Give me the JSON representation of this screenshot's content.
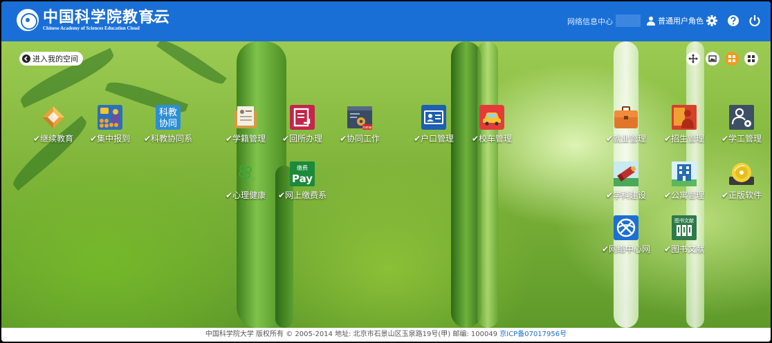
{
  "header": {
    "logo_cn": "中国科学院教育云",
    "logo_en": "Chinese Academy of Sciences Education Cloud",
    "net_center": "网络信息中心",
    "role": "普通用户角色"
  },
  "toolbar": {
    "enter_space": "进入我的空间"
  },
  "apps": [
    {
      "id": "continuing-education",
      "label": "✔继续教育",
      "icon": "continuing-education-icon"
    },
    {
      "id": "centralized-registration",
      "label": "✔集中报到",
      "icon": "registration-icon"
    },
    {
      "id": "research-collaboration",
      "label": "✔科教协同系",
      "icon": "research-collaboration-icon",
      "icon_text_1": "科教",
      "icon_text_2": "协同"
    },
    {
      "id": "student-records",
      "label": "✔学籍管理",
      "icon": "student-records-icon"
    },
    {
      "id": "institute-affairs",
      "label": "✔回所办理",
      "icon": "institute-affairs-icon"
    },
    {
      "id": "collaborative-work",
      "label": "✔协同工作",
      "icon": "collaborative-work-icon",
      "badge": "new"
    },
    {
      "id": "household-registration",
      "label": "✔户口管理",
      "icon": "id-card-icon"
    },
    {
      "id": "shuttle-bus",
      "label": "✔校车管理",
      "icon": "car-icon"
    },
    {
      "id": "mental-health",
      "label": "✔心理健康",
      "icon": "clover-icon"
    },
    {
      "id": "online-payment",
      "label": "✔网上缴费系",
      "icon": "pay-icon",
      "icon_text_1": "缴费",
      "icon_text_2": "Pay"
    },
    {
      "id": "employment",
      "label": "✔就业管理",
      "icon": "briefcase-icon"
    },
    {
      "id": "admissions",
      "label": "✔招生管理",
      "icon": "admissions-icon"
    },
    {
      "id": "student-affairs",
      "label": "✔学工管理",
      "icon": "student-affairs-icon"
    },
    {
      "id": "discipline-building",
      "label": "✔学科建设",
      "icon": "discipline-icon"
    },
    {
      "id": "apartment",
      "label": "✔公寓管理",
      "icon": "apartment-icon"
    },
    {
      "id": "licensed-software",
      "label": "✔正版软件",
      "icon": "software-disc-icon"
    },
    {
      "id": "network-center",
      "label": "✔网络中心网",
      "icon": "network-icon"
    },
    {
      "id": "library",
      "label": "✔图书文献",
      "icon": "library-icon",
      "icon_text_1": "图书文献"
    }
  ],
  "footer": {
    "copyright": "中国科学院大学 版权所有 © 2005-2014 地址: 北京市石景山区玉泉路19号(甲) 邮编: 100049",
    "icp": "京ICP备07017956号"
  },
  "colors": {
    "header_bg": "#1a6fd6",
    "link": "#1a6fd6"
  }
}
